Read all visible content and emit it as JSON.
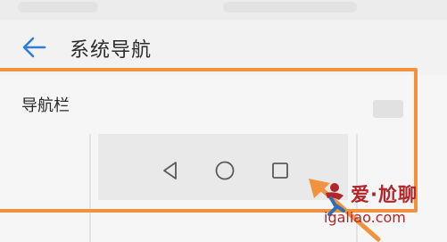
{
  "header": {
    "title": "系统导航"
  },
  "section": {
    "navbar_label": "导航栏"
  },
  "nav_keys": [
    "back",
    "home",
    "recents"
  ],
  "accent": "#f0923e",
  "watermark": {
    "brand": "爱·尬聊",
    "url": "igaliao.com"
  }
}
